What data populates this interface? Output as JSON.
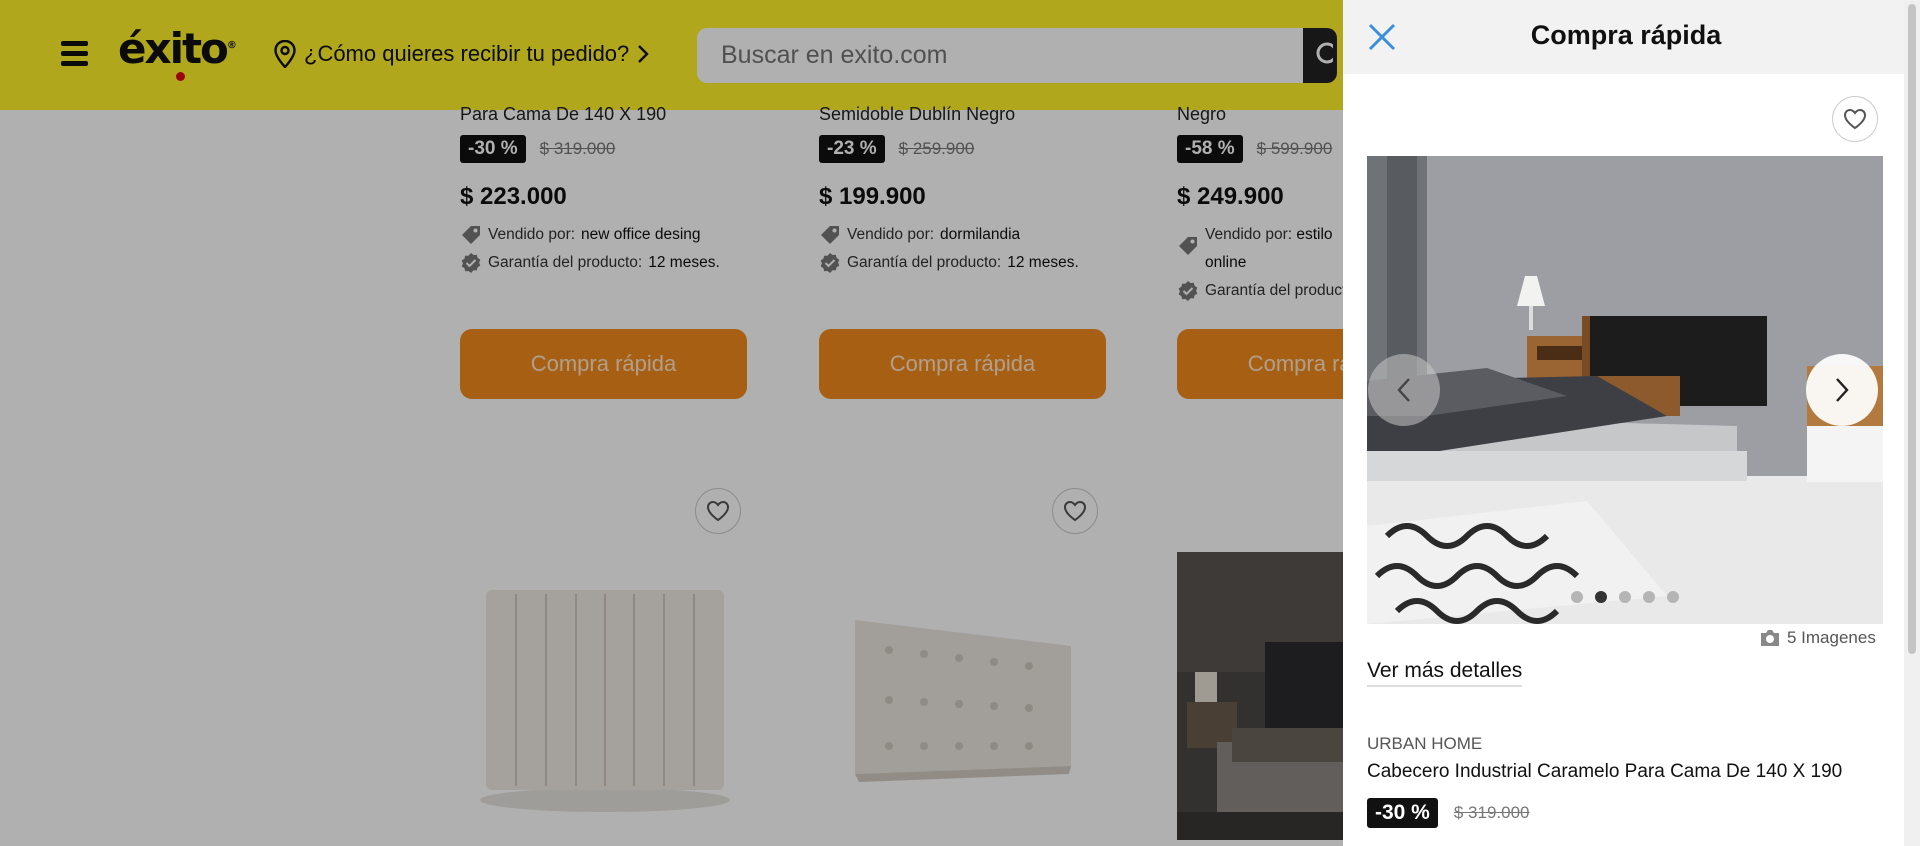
{
  "header": {
    "logo": "éxito",
    "logo_mark": "®",
    "delivery_prompt": "¿Cómo quieres recibir tu pedido?",
    "search_placeholder": "Buscar en exito.com",
    "colors": {
      "bar": "#fff22b",
      "logo_dot": "#e30613"
    }
  },
  "products": [
    {
      "name": "Para Cama De 140 X 190",
      "discount": "-30 %",
      "old_price": "$ 319.000",
      "price": "$ 223.000",
      "sold_by_label": "Vendido por:",
      "seller": "new office desing",
      "warranty_label": "Garantía del producto:",
      "warranty": "12 meses.",
      "button": "Compra rápida"
    },
    {
      "name": "Semidoble Dublín Negro",
      "discount": "-23 %",
      "old_price": "$ 259.900",
      "price": "$ 199.900",
      "sold_by_label": "Vendido por:",
      "seller": "dormilandia",
      "warranty_label": "Garantía del producto:",
      "warranty": "12 meses.",
      "button": "Compra rápida"
    },
    {
      "name": "Negro",
      "discount": "-58 %",
      "old_price": "$ 599.900",
      "price": "$ 249.900",
      "sold_by_label": "Vendido por:",
      "seller": "estilo",
      "seller_line2": "online",
      "warranty_label": "Garantía del producto:",
      "warranty": "",
      "button": "Compra rápida"
    }
  ],
  "quick_buy": {
    "title": "Compra rápida",
    "image_count": "5 Imagenes",
    "details_link": "Ver más detalles",
    "brand": "URBAN HOME",
    "product_name": "Cabecero Industrial Caramelo Para Cama De 140 X 190",
    "discount": "-30 %",
    "old_price": "$ 319.000",
    "slides": {
      "total": 5,
      "active_index": 1
    }
  },
  "icons": [
    "menu-icon",
    "location-pin-icon",
    "chevron-right-icon",
    "search-icon",
    "tag-icon",
    "verified-badge-icon",
    "heart-icon",
    "close-icon",
    "chevron-left-icon",
    "camera-icon"
  ],
  "accent_colors": {
    "button": "#f28a1e",
    "discount_badge": "#111111",
    "close_icon": "#3a8fd9"
  }
}
